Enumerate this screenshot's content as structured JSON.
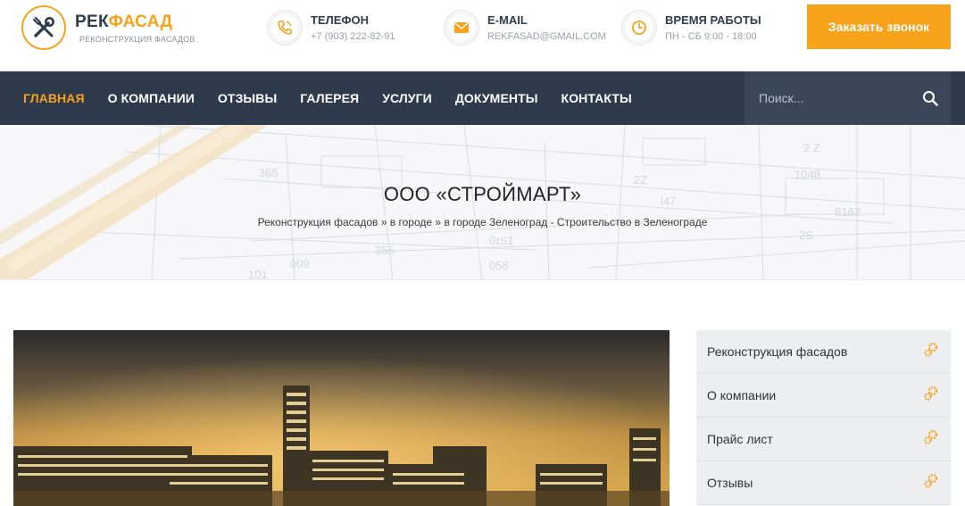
{
  "logo": {
    "title_a": "РЕК",
    "title_b": "ФАСАД",
    "subtitle": "РЕКОНСТРУКЦИЯ ФАСАДОВ"
  },
  "header": {
    "phone": {
      "label": "ТЕЛЕФОН",
      "value": "+7 (903) 222-82-91"
    },
    "email": {
      "label": "E-MAIL",
      "value": "REKFASAD@GMAIL.COM"
    },
    "hours": {
      "label": "ВРЕМЯ РАБОТЫ",
      "value": "ПН - СБ 9:00 - 18:00"
    },
    "cta_label": "Заказать звонок"
  },
  "nav": {
    "items": [
      {
        "label": "ГЛАВНАЯ"
      },
      {
        "label": "О КОМПАНИИ"
      },
      {
        "label": "ОТЗЫВЫ"
      },
      {
        "label": "ГАЛЕРЕЯ"
      },
      {
        "label": "УСЛУГИ"
      },
      {
        "label": "ДОКУМЕНТЫ"
      },
      {
        "label": "КОНТАКТЫ"
      }
    ],
    "search_placeholder": "Поиск..."
  },
  "hero": {
    "title": "ООО «СТРОЙМАРТ»",
    "breadcrumbs": [
      "Реконструкция фасадов",
      "в городе",
      "в городе Зеленоград - Строительство в Зеленограде"
    ],
    "separator": "»"
  },
  "sidebar": {
    "items": [
      {
        "label": "Реконструкция фасадов"
      },
      {
        "label": "О компании"
      },
      {
        "label": "Прайс лист"
      },
      {
        "label": "Отзывы"
      }
    ]
  },
  "colors": {
    "accent": "#f7a21b",
    "nav_bg": "#2e3b4c",
    "search_bg": "#3a4759"
  }
}
